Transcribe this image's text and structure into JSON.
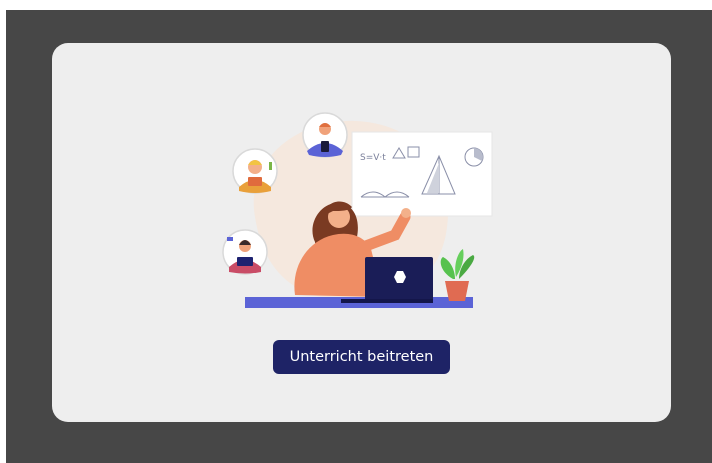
{
  "dialog": {
    "join_button_label": "Unterricht beitreten",
    "colors": {
      "backdrop": "#474747",
      "card": "#eeeeee",
      "button": "#1e2366",
      "button_text": "#ffffff"
    }
  },
  "illustration": {
    "icon": "teacher-online-class-illustration",
    "whiteboard_text": "S=V·t"
  }
}
